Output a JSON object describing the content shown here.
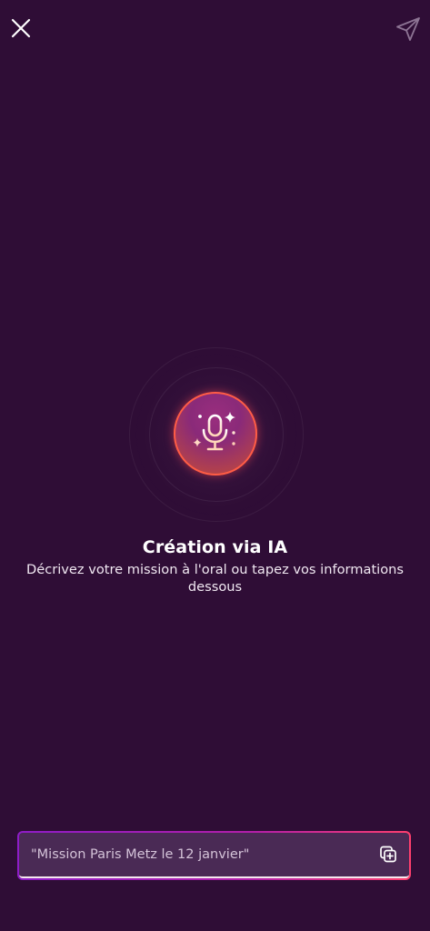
{
  "header": {
    "close_icon": "close-icon",
    "send_icon": "send-icon"
  },
  "mic": {
    "icon": "ai-microphone-sparkle-icon"
  },
  "content": {
    "title": "Création via IA",
    "subtitle": "Décrivez votre mission à l'oral ou tapez vos informations dessous"
  },
  "input": {
    "placeholder": "\"Mission Paris Metz le 12 janvier\"",
    "value": "",
    "paste_icon": "paste-icon"
  },
  "colors": {
    "background": "#2f0d36",
    "accent_orange": "#ff5c45",
    "accent_purple": "#8e1cc7"
  }
}
